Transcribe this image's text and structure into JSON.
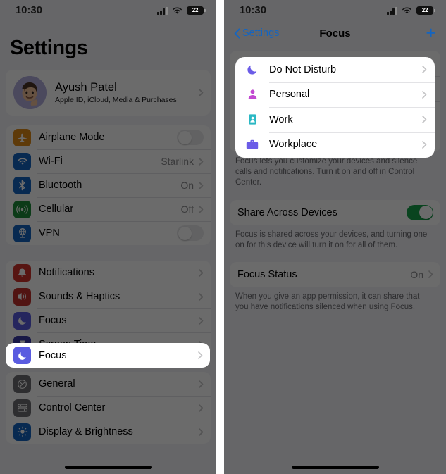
{
  "colors": {
    "accent_blue": "#1565c0",
    "toggle_green": "#17a34a",
    "focus_indigo": "#5a5ce0",
    "dnd_purple": "#6b5ce7",
    "personal_magenta": "#c24ad1",
    "work_teal": "#2bb8c4",
    "workplace_purple": "#6b5ce7",
    "airplane_orange": "#e08b16",
    "wifi_blue": "#1565c0",
    "cellular_green": "#1e8c3a",
    "notifications_red": "#d0342c",
    "gray_icon": "#8a8a8e"
  },
  "left_phone": {
    "status_bar": {
      "time": "10:30",
      "battery_level": "22",
      "signal_icon": "cellular-bars-icon",
      "wifi_icon": "wifi-icon",
      "battery_icon": "battery-icon"
    },
    "page_title": "Settings",
    "account": {
      "name": "Ayush Patel",
      "subtitle": "Apple ID, iCloud, Media & Purchases",
      "avatar_icon": "memoji-avatar"
    },
    "groups": [
      {
        "rows": [
          {
            "label": "Airplane Mode",
            "icon": "airplane-icon",
            "icon_color": "#e08b16",
            "control": "toggle",
            "toggle_on": false
          },
          {
            "label": "Wi-Fi",
            "icon": "wifi-icon",
            "icon_color": "#1565c0",
            "control": "value",
            "value": "Starlink"
          },
          {
            "label": "Bluetooth",
            "icon": "bluetooth-icon",
            "icon_color": "#1565c0",
            "control": "value",
            "value": "On"
          },
          {
            "label": "Cellular",
            "icon": "cellular-icon",
            "icon_color": "#1e8c3a",
            "control": "value",
            "value": "Off"
          },
          {
            "label": "VPN",
            "icon": "vpn-icon",
            "icon_color": "#1565c0",
            "control": "toggle",
            "toggle_on": false
          }
        ]
      },
      {
        "rows": [
          {
            "label": "Notifications",
            "icon": "bell-icon",
            "icon_color": "#d0342c",
            "control": "chevron"
          },
          {
            "label": "Sounds & Haptics",
            "icon": "speaker-icon",
            "icon_color": "#c0302c",
            "control": "chevron"
          },
          {
            "label": "Focus",
            "icon": "moon-icon",
            "icon_color": "#5a5ce0",
            "control": "chevron",
            "highlighted": true
          },
          {
            "label": "Screen Time",
            "icon": "hourglass-icon",
            "icon_color": "#3b3ba8",
            "control": "chevron"
          }
        ]
      },
      {
        "rows": [
          {
            "label": "General",
            "icon": "gear-icon",
            "icon_color": "#6e6e73",
            "control": "chevron"
          },
          {
            "label": "Control Center",
            "icon": "sliders-icon",
            "icon_color": "#6e6e73",
            "control": "chevron"
          },
          {
            "label": "Display & Brightness",
            "icon": "brightness-icon",
            "icon_color": "#1565c0",
            "control": "chevron"
          }
        ]
      }
    ]
  },
  "right_phone": {
    "status_bar": {
      "time": "10:30",
      "battery_level": "22",
      "signal_icon": "cellular-bars-icon",
      "wifi_icon": "wifi-icon",
      "battery_icon": "battery-icon"
    },
    "navbar": {
      "back_label": "Settings",
      "back_icon": "chevron-left-icon",
      "title": "Focus",
      "add_label": "+",
      "add_icon": "plus-icon"
    },
    "focus_list": [
      {
        "label": "Do Not Disturb",
        "icon": "moon-icon",
        "icon_color": "#6b5ce7"
      },
      {
        "label": "Personal",
        "icon": "person-icon",
        "icon_color": "#c24ad1"
      },
      {
        "label": "Work",
        "icon": "id-badge-icon",
        "icon_color": "#2bb8c4"
      },
      {
        "label": "Workplace",
        "icon": "briefcase-icon",
        "icon_color": "#6b5ce7"
      }
    ],
    "focus_footnote": "Focus lets you customize your devices and silence calls and notifications. Turn it on and off in Control Center.",
    "share_row": {
      "label": "Share Across Devices",
      "toggle_on": true
    },
    "share_footnote": "Focus is shared across your devices, and turning one on for this device will turn it on for all of them.",
    "status_row": {
      "label": "Focus Status",
      "value": "On"
    },
    "status_footnote": "When you give an app permission, it can share that you have notifications silenced when using Focus."
  }
}
